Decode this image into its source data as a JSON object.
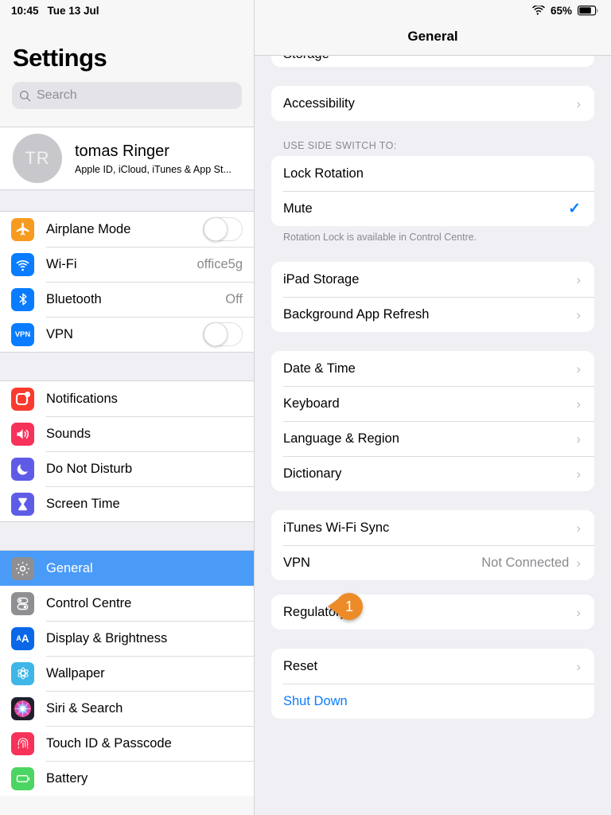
{
  "status_bar": {
    "time": "10:45",
    "date": "Tue 13 Jul",
    "battery_percent": "65%",
    "wifi_icon": "wifi-icon",
    "battery_icon": "battery-icon"
  },
  "sidebar": {
    "title": "Settings",
    "search": {
      "placeholder": "Search",
      "value": "",
      "icon": "search-icon"
    },
    "profile": {
      "initials": "TR",
      "name": "tomas Ringer",
      "subtitle": "Apple ID, iCloud, iTunes & App St..."
    },
    "groups": [
      {
        "items": [
          {
            "label": "Airplane Mode",
            "icon": "airplane-icon",
            "icon_color": "#F79B20",
            "control": "toggle",
            "value": "off"
          },
          {
            "label": "Wi-Fi",
            "icon": "wifi-icon",
            "icon_color": "#0A7CFF",
            "control": "value",
            "value": "office5g"
          },
          {
            "label": "Bluetooth",
            "icon": "bluetooth-icon",
            "icon_color": "#0A7CFF",
            "control": "value",
            "value": "Off"
          },
          {
            "label": "VPN",
            "icon": "vpn-icon",
            "icon_color": "#0A7CFF",
            "control": "toggle",
            "value": "off"
          }
        ]
      },
      {
        "items": [
          {
            "label": "Notifications",
            "icon": "notifications-icon",
            "icon_color": "#FA3A2E"
          },
          {
            "label": "Sounds",
            "icon": "sounds-icon",
            "icon_color": "#F7325A"
          },
          {
            "label": "Do Not Disturb",
            "icon": "moon-icon",
            "icon_color": "#5E5CE6"
          },
          {
            "label": "Screen Time",
            "icon": "hourglass-icon",
            "icon_color": "#5E5CE6"
          }
        ]
      },
      {
        "items": [
          {
            "label": "General",
            "icon": "gear-icon",
            "icon_color": "#8E8E93",
            "selected": true
          },
          {
            "label": "Control Centre",
            "icon": "control-centre-icon",
            "icon_color": "#8E8E93"
          },
          {
            "label": "Display & Brightness",
            "icon": "display-brightness-icon",
            "icon_color": "#0A68E8"
          },
          {
            "label": "Wallpaper",
            "icon": "wallpaper-icon",
            "icon_color": "#3FB6E8"
          },
          {
            "label": "Siri & Search",
            "icon": "siri-icon",
            "icon_color": "#2A2A3A"
          },
          {
            "label": "Touch ID & Passcode",
            "icon": "fingerprint-icon",
            "icon_color": "#F7325A"
          },
          {
            "label": "Battery",
            "icon": "battery-green-icon",
            "icon_color": "#4CD562"
          }
        ]
      }
    ]
  },
  "detail": {
    "title": "General",
    "clipped_top_row": "Storage",
    "sections": [
      {
        "header": "",
        "footer": "",
        "rows": [
          {
            "label": "Accessibility",
            "accessory": "chevron"
          }
        ]
      },
      {
        "header": "USE SIDE SWITCH TO:",
        "footer": "Rotation Lock is available in Control Centre.",
        "rows": [
          {
            "label": "Lock Rotation",
            "accessory": "none"
          },
          {
            "label": "Mute",
            "accessory": "check"
          }
        ]
      },
      {
        "header": "",
        "footer": "",
        "rows": [
          {
            "label": "iPad Storage",
            "accessory": "chevron"
          },
          {
            "label": "Background App Refresh",
            "accessory": "chevron"
          }
        ]
      },
      {
        "header": "",
        "footer": "",
        "rows": [
          {
            "label": "Date & Time",
            "accessory": "chevron"
          },
          {
            "label": "Keyboard",
            "accessory": "chevron"
          },
          {
            "label": "Language & Region",
            "accessory": "chevron"
          },
          {
            "label": "Dictionary",
            "accessory": "chevron"
          }
        ]
      },
      {
        "header": "",
        "footer": "",
        "rows": [
          {
            "label": "iTunes Wi-Fi Sync",
            "accessory": "chevron"
          },
          {
            "label": "VPN",
            "value": "Not Connected",
            "accessory": "chevron",
            "annotated": true
          }
        ]
      },
      {
        "header": "",
        "footer": "",
        "rows": [
          {
            "label": "Regulatory",
            "accessory": "chevron"
          }
        ]
      },
      {
        "header": "",
        "footer": "",
        "rows": [
          {
            "label": "Reset",
            "accessory": "chevron"
          },
          {
            "label": "Shut Down",
            "accessory": "none",
            "style": "blue"
          }
        ]
      }
    ]
  },
  "annotation": {
    "number": "1",
    "color": "#ED8B28"
  }
}
